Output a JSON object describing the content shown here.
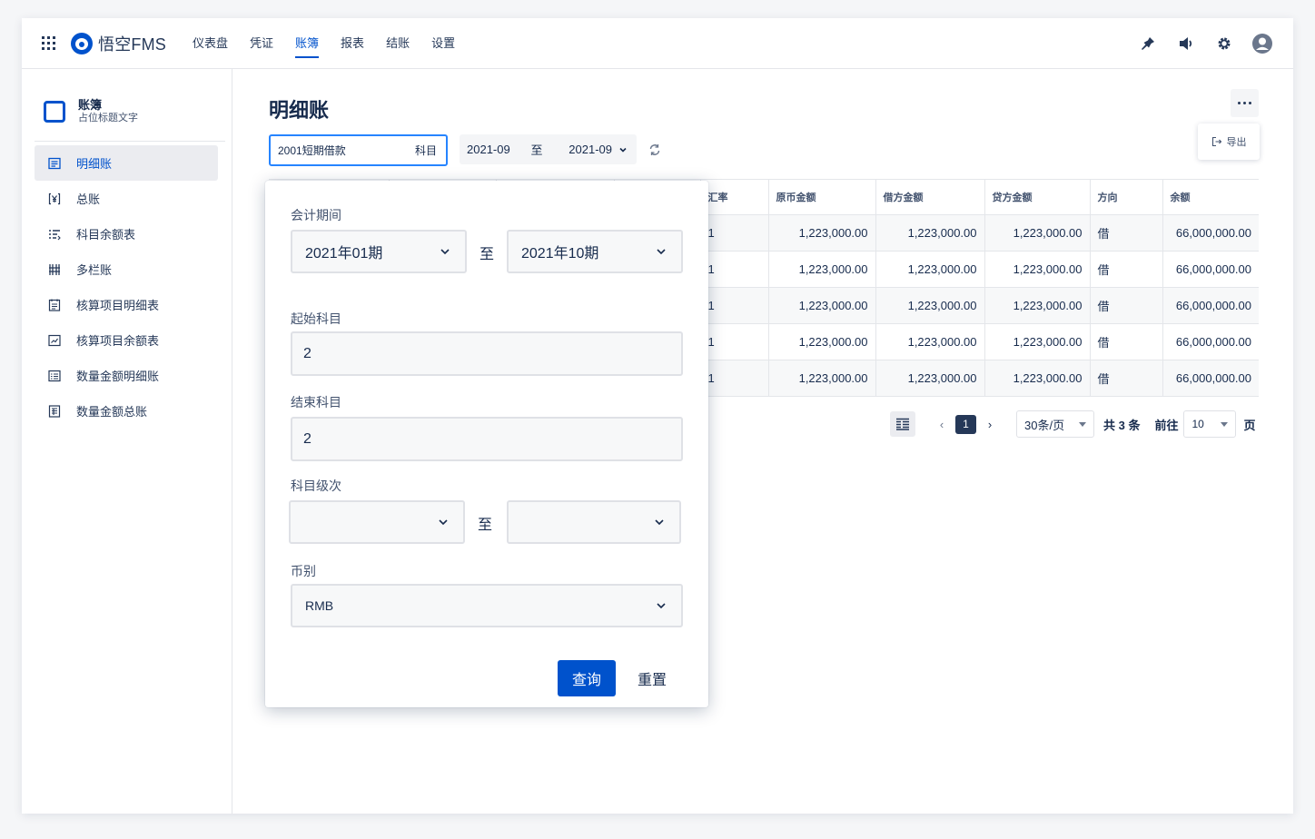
{
  "app": {
    "name": "悟空FMS"
  },
  "nav": {
    "items": [
      "仪表盘",
      "凭证",
      "账簿",
      "报表",
      "结账",
      "设置"
    ],
    "active": "账簿"
  },
  "sidebar": {
    "title": "账簿",
    "subtitle": "占位标题文字",
    "items": [
      {
        "label": "明细账",
        "icon": "ledger-detail-icon",
        "active": true
      },
      {
        "label": "总账",
        "icon": "yuan-icon"
      },
      {
        "label": "科目余额表",
        "icon": "list-icon"
      },
      {
        "label": "多栏账",
        "icon": "columns-icon"
      },
      {
        "label": "核算项目明细表",
        "icon": "doc-icon"
      },
      {
        "label": "核算项目余额表",
        "icon": "trend-icon"
      },
      {
        "label": "数量金额明细账",
        "icon": "list-doc-icon"
      },
      {
        "label": "数量金额总账",
        "icon": "sheet-icon"
      }
    ]
  },
  "page": {
    "title": "明细账",
    "export_label": "导出",
    "subject_value": "2001短期借款",
    "subject_suffix": "科目",
    "period_from": "2021-09",
    "period_sep": "至",
    "period_to": "2021-09"
  },
  "table": {
    "columns": [
      "",
      "",
      "",
      "",
      "汇率",
      "原币金额",
      "借方金额",
      "贷方金额",
      "方向",
      "余额"
    ],
    "rows": [
      [
        "",
        "",
        "",
        "",
        "1",
        "1,223,000.00",
        "1,223,000.00",
        "1,223,000.00",
        "借",
        "66,000,000.00"
      ],
      [
        "",
        "",
        "",
        "",
        "1",
        "1,223,000.00",
        "1,223,000.00",
        "1,223,000.00",
        "借",
        "66,000,000.00"
      ],
      [
        "",
        "",
        "",
        "",
        "1",
        "1,223,000.00",
        "1,223,000.00",
        "1,223,000.00",
        "借",
        "66,000,000.00"
      ],
      [
        "",
        "",
        "",
        "",
        "1",
        "1,223,000.00",
        "1,223,000.00",
        "1,223,000.00",
        "借",
        "66,000,000.00"
      ],
      [
        "",
        "",
        "",
        "",
        "1",
        "1,223,000.00",
        "1,223,000.00",
        "1,223,000.00",
        "借",
        "66,000,000.00"
      ]
    ]
  },
  "pagination": {
    "current": "1",
    "page_size": "30条/页",
    "total": "共 3 条",
    "goto_label": "前往",
    "goto_value": "10",
    "page_suffix": "页"
  },
  "filter": {
    "period_label": "会计期间",
    "period_from": "2021年01期",
    "period_sep": "至",
    "period_to": "2021年10期",
    "start_subject_label": "起始科目",
    "start_subject_value": "2",
    "end_subject_label": "结束科目",
    "end_subject_value": "2",
    "level_label": "科目级次",
    "level_from": "",
    "level_sep": "至",
    "level_to": "",
    "currency_label": "币别",
    "currency_value": "RMB",
    "query_label": "查询",
    "reset_label": "重置"
  },
  "colors": {
    "accent": "#0052cc",
    "text": "#172b4d",
    "muted": "#42526e"
  }
}
